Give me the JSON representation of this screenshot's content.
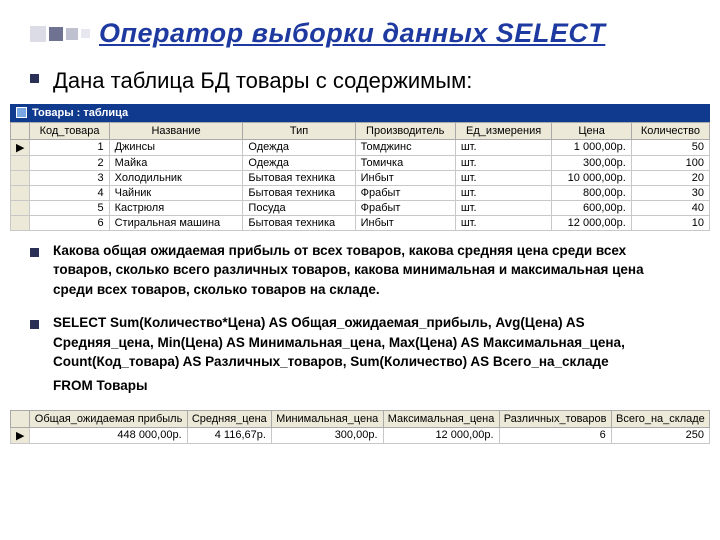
{
  "title": "Оператор выборки данных SELECT",
  "subtitle": "Дана таблица БД товары с содержимым:",
  "window_caption": "Товары : таблица",
  "columns": [
    "Код_товара",
    "Название",
    "Тип",
    "Производитель",
    "Ед_измерения",
    "Цена",
    "Количество"
  ],
  "rows": [
    {
      "id": "1",
      "name": "Джинсы",
      "type": "Одежда",
      "prod": "Томджинс",
      "unit": "шт.",
      "price": "1 000,00р.",
      "qty": "50"
    },
    {
      "id": "2",
      "name": "Майка",
      "type": "Одежда",
      "prod": "Томичка",
      "unit": "шт.",
      "price": "300,00р.",
      "qty": "100"
    },
    {
      "id": "3",
      "name": "Холодильник",
      "type": "Бытовая техника",
      "prod": "Инбыт",
      "unit": "шт.",
      "price": "10 000,00р.",
      "qty": "20"
    },
    {
      "id": "4",
      "name": "Чайник",
      "type": "Бытовая техника",
      "prod": "Фрабыт",
      "unit": "шт.",
      "price": "800,00р.",
      "qty": "30"
    },
    {
      "id": "5",
      "name": "Кастрюля",
      "type": "Посуда",
      "prod": "Фрабыт",
      "unit": "шт.",
      "price": "600,00р.",
      "qty": "40"
    },
    {
      "id": "6",
      "name": "Стиральная машина",
      "type": "Бытовая техника",
      "prod": "Инбыт",
      "unit": "шт.",
      "price": "12 000,00р.",
      "qty": "10"
    }
  ],
  "question": "Какова общая ожидаемая прибыль от всех товаров, какова средняя цена среди всех товаров, сколько всего различных товаров, какова минимальная и максимальная цена среди всех товаров, сколько товаров на складе.",
  "sql_line1": "SELECT Sum(Количество*Цена) AS Общая_ожидаемая_прибыль, Avg(Цена) AS Средняя_цена, Min(Цена) AS Минимальная_цена, Max(Цена) AS Максимальная_цена, Count(Код_товара) AS Различных_товаров, Sum(Количество) AS Всего_на_складе",
  "sql_line2": "FROM Товары",
  "result_columns": [
    "Общая_ожидаемая прибыль",
    "Средняя_цена",
    "Минимальная_цена",
    "Максимальная_цена",
    "Различных_товаров",
    "Всего_на_складе"
  ],
  "result_row": [
    "448 000,00р.",
    "4 116,67р.",
    "300,00р.",
    "12 000,00р.",
    "6",
    "250"
  ],
  "row_marker": "▶"
}
